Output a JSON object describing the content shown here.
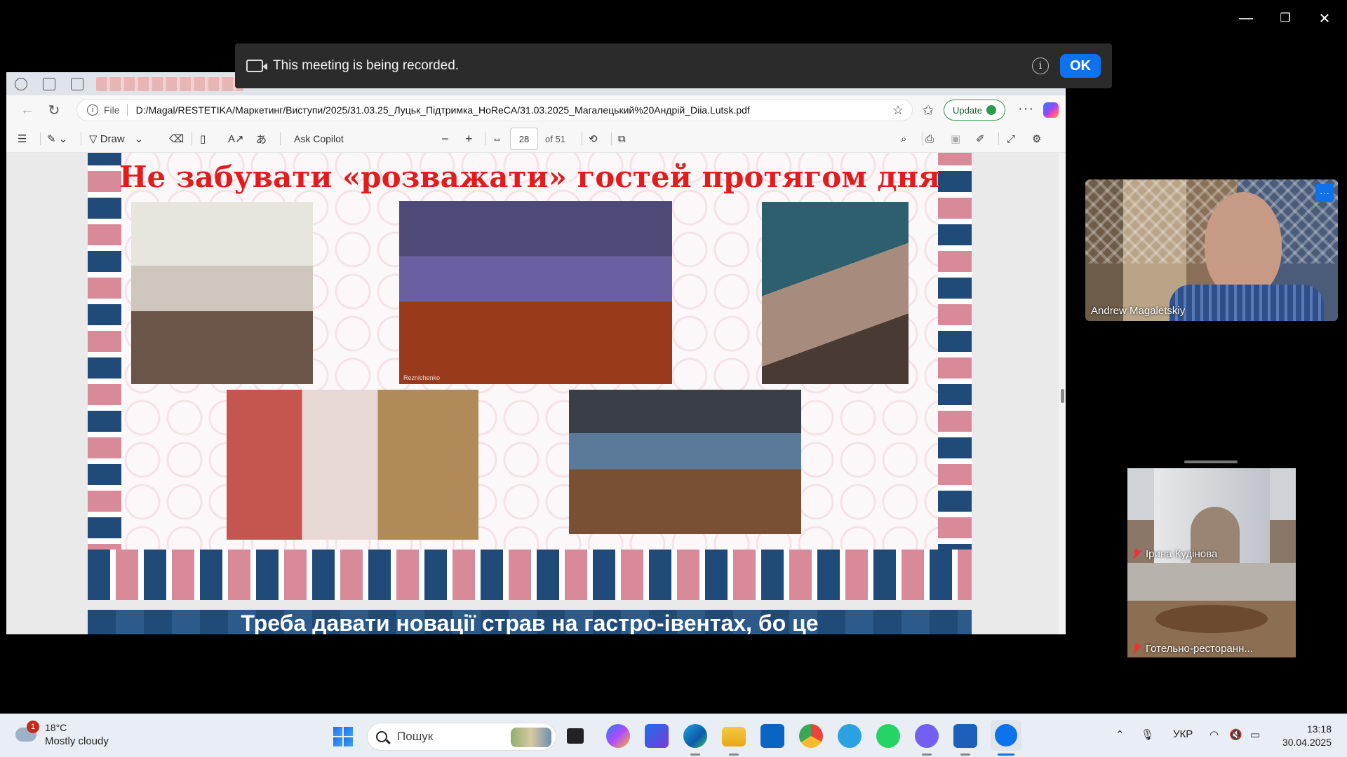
{
  "window": {
    "minimize": "—",
    "restore": "❐",
    "close": "✕"
  },
  "recording_banner": {
    "text": "This meeting is being recorded.",
    "info": "i",
    "ok_label": "OK"
  },
  "browser": {
    "address": {
      "scheme_label": "File",
      "url": "D:/Magal/RESTETIKA/Маркетинг/Виступи/2025/31.03.25_Луцьк_Підтримка_HoReCA/31.03.2025_Магалецький%20Андрій_Diia.Lutsk.pdf",
      "update_label": "Update"
    },
    "pdf_toolbar": {
      "draw_label": "Draw",
      "ask_copilot_label": "Ask Copilot",
      "page_current": "28",
      "page_total": "of 51"
    }
  },
  "slide": {
    "title": "Не забувати «розважати» гостей протягом дня",
    "photo_watermark": "Reznichenko",
    "next_slide_title": "Треба давати новації страв на гастро-івентах, бо це"
  },
  "participants": {
    "main": {
      "name": "Andrew Magaletskiy"
    },
    "small": [
      {
        "name": "Ірина  Кудінова"
      },
      {
        "name": "Готельно-ресторанн..."
      }
    ]
  },
  "taskbar": {
    "weather": {
      "badge": "1",
      "temp": "18°C",
      "desc": "Mostly cloudy"
    },
    "search_placeholder": "Пошук",
    "language": "УКР",
    "time": "13:18",
    "date": "30.04.2025"
  },
  "colors": {
    "title_red": "#e21c1c",
    "zoom_blue": "#0e72ed",
    "slide_navy": "#204a78",
    "slide_pink": "#d98a99"
  }
}
